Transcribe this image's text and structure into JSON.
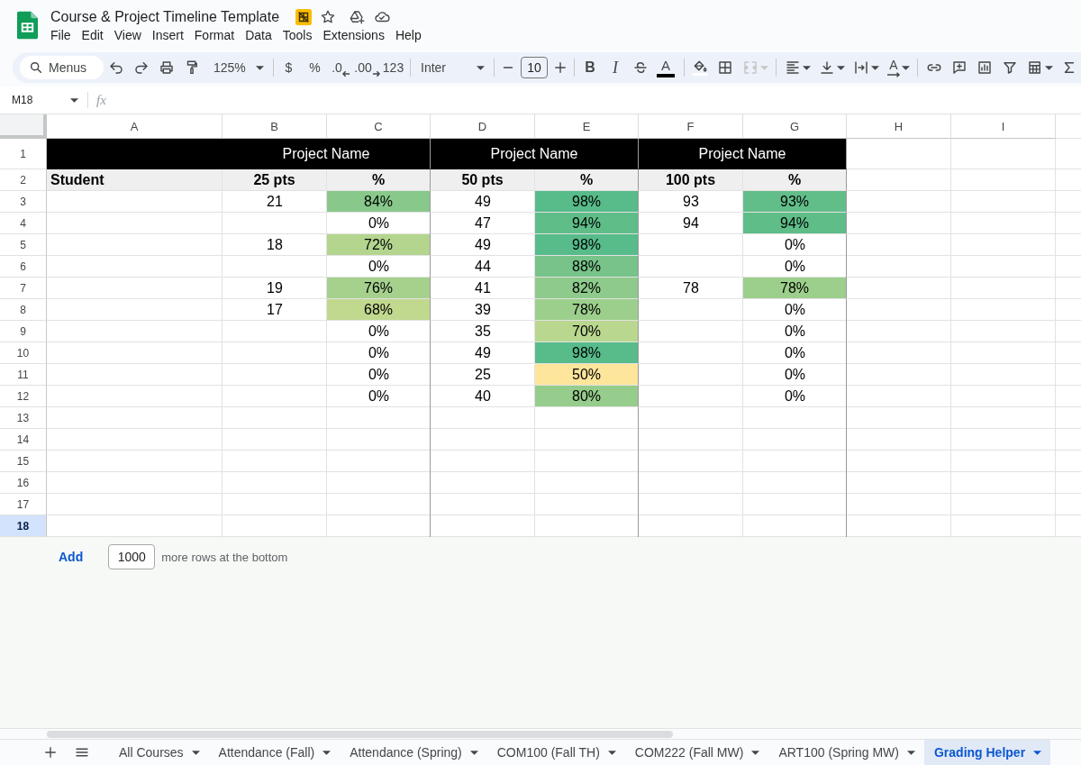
{
  "title_bar": {
    "title": "Course & Project Timeline Template",
    "menus": [
      "File",
      "Edit",
      "View",
      "Insert",
      "Format",
      "Data",
      "Tools",
      "Extensions",
      "Help"
    ]
  },
  "toolbar": {
    "search": {
      "placeholder": "Menus"
    },
    "zoom": "125%",
    "number_formats": [
      {
        "label": "$",
        "kind": "plain"
      },
      {
        "label": "%",
        "kind": "plain"
      },
      {
        "label": ".0",
        "kind": "decrease"
      },
      {
        "label": ".00",
        "kind": "increase"
      },
      {
        "label": "123",
        "kind": "plain"
      }
    ],
    "font": "Inter",
    "font_size": "10",
    "bold_button": "B",
    "italic_button": "I",
    "text_color_button": "A",
    "merge_cells": {
      "disabled": true
    },
    "text_rotation_button": "A"
  },
  "formula_bar": {
    "cell_ref": "M18",
    "function_label": "fx"
  },
  "grid": {
    "columns": [
      "A",
      "B",
      "C",
      "D",
      "E",
      "F",
      "G",
      "H",
      "I"
    ],
    "rows": [
      {
        "number": "1",
        "selected": false,
        "kind": "banner",
        "groups": [
          {
            "title": "Project Name"
          },
          {
            "title": "Project Name"
          },
          {
            "title": "Project Name"
          }
        ]
      },
      {
        "number": "2",
        "selected": false,
        "kind": "header",
        "label": "Student",
        "groups": [
          {
            "points": "25 pts",
            "percent": "%"
          },
          {
            "points": "50 pts",
            "percent": "%"
          },
          {
            "points": "100 pts",
            "percent": "%"
          }
        ]
      },
      {
        "number": "3",
        "selected": false,
        "kind": "scores",
        "groups": [
          {
            "points": "21",
            "percent": "84%",
            "color": "#88c98b"
          },
          {
            "points": "49",
            "percent": "98%",
            "color": "#57bb8a"
          },
          {
            "points": "93",
            "percent": "93%",
            "color": "#62be89"
          }
        ]
      },
      {
        "number": "4",
        "selected": false,
        "kind": "scores",
        "groups": [
          {
            "percent": "0%"
          },
          {
            "points": "47",
            "percent": "94%",
            "color": "#5fbd88"
          },
          {
            "points": "94",
            "percent": "94%",
            "color": "#5fbd88"
          }
        ]
      },
      {
        "number": "5",
        "selected": false,
        "kind": "scores",
        "groups": [
          {
            "points": "18",
            "percent": "72%",
            "color": "#b3d58e"
          },
          {
            "points": "49",
            "percent": "98%",
            "color": "#57bb8a"
          },
          {
            "percent": "0%"
          }
        ]
      },
      {
        "number": "6",
        "selected": false,
        "kind": "scores",
        "groups": [
          {
            "percent": "0%"
          },
          {
            "points": "44",
            "percent": "88%",
            "color": "#77c38a"
          },
          {
            "percent": "0%"
          }
        ]
      },
      {
        "number": "7",
        "selected": false,
        "kind": "scores",
        "groups": [
          {
            "points": "19",
            "percent": "76%",
            "color": "#a5d18d"
          },
          {
            "points": "41",
            "percent": "82%",
            "color": "#8eca8b"
          },
          {
            "points": "78",
            "percent": "78%",
            "color": "#9dcf8c"
          }
        ]
      },
      {
        "number": "8",
        "selected": false,
        "kind": "scores",
        "groups": [
          {
            "points": "17",
            "percent": "68%",
            "color": "#c1d98f"
          },
          {
            "points": "39",
            "percent": "78%",
            "color": "#9dcf8c"
          },
          {
            "percent": "0%"
          }
        ]
      },
      {
        "number": "9",
        "selected": false,
        "kind": "scores",
        "groups": [
          {
            "percent": "0%"
          },
          {
            "points": "35",
            "percent": "70%",
            "color": "#bad78f"
          },
          {
            "percent": "0%"
          }
        ]
      },
      {
        "number": "10",
        "selected": false,
        "kind": "scores",
        "groups": [
          {
            "percent": "0%"
          },
          {
            "points": "49",
            "percent": "98%",
            "color": "#57bb8a"
          },
          {
            "percent": "0%"
          }
        ]
      },
      {
        "number": "11",
        "selected": false,
        "kind": "scores",
        "groups": [
          {
            "percent": "0%"
          },
          {
            "points": "25",
            "percent": "50%",
            "color": "#fde59b"
          },
          {
            "percent": "0%"
          }
        ]
      },
      {
        "number": "12",
        "selected": false,
        "kind": "scores",
        "groups": [
          {
            "percent": "0%"
          },
          {
            "points": "40",
            "percent": "80%",
            "color": "#96cc8c"
          },
          {
            "percent": "0%"
          }
        ]
      },
      {
        "number": "13",
        "selected": false,
        "kind": "blank"
      },
      {
        "number": "14",
        "selected": false,
        "kind": "blank"
      },
      {
        "number": "15",
        "selected": false,
        "kind": "blank"
      },
      {
        "number": "16",
        "selected": false,
        "kind": "blank"
      },
      {
        "number": "17",
        "selected": false,
        "kind": "blank"
      },
      {
        "number": "18",
        "selected": true,
        "kind": "blank"
      }
    ]
  },
  "add_rows": {
    "button": "Add",
    "count": "1000",
    "suffix": "more rows at the bottom"
  },
  "sheet_tabs": [
    {
      "label": "All Courses",
      "selected": false
    },
    {
      "label": "Attendance (Fall)",
      "selected": false
    },
    {
      "label": "Attendance (Spring)",
      "selected": false
    },
    {
      "label": "COM100 (Fall TH)",
      "selected": false
    },
    {
      "label": "COM222 (Fall MW)",
      "selected": false
    },
    {
      "label": "ART100 (Spring MW)",
      "selected": false
    },
    {
      "label": "Grading Helper",
      "selected": true
    }
  ]
}
